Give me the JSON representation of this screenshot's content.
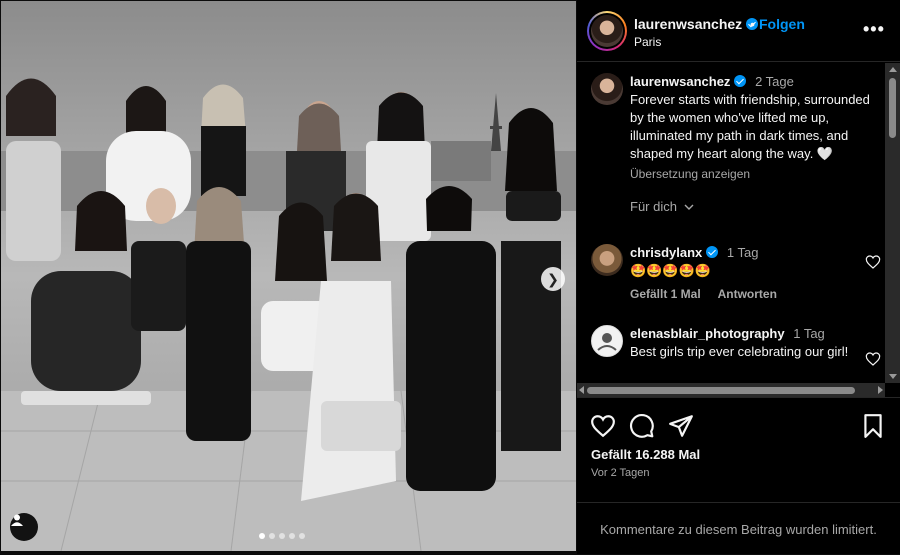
{
  "header": {
    "username": "laurenwsanchez",
    "separator": "•",
    "follow_label": "Folgen",
    "location": "Paris",
    "more_label": "•••"
  },
  "caption": {
    "username": "laurenwsanchez",
    "time": "2 Tage",
    "text": "Forever starts with friendship, surrounded by the women who've lifted me up, illuminated my path in dark times, and shaped my heart along the way. 🤍",
    "translate_label": "Übersetzung anzeigen",
    "for_you_label": "Für dich"
  },
  "comments": [
    {
      "username": "chrisdylanx",
      "time": "1 Tag",
      "text": "🤩🤩🤩🤩🤩",
      "likes_label": "Gefällt 1 Mal",
      "reply_label": "Antworten",
      "verified": true
    },
    {
      "username": "elenasblair_photography",
      "time": "1 Tag",
      "text": "Best girls trip ever celebrating our girl!",
      "verified": false
    }
  ],
  "footer": {
    "likes": "Gefällt 16.288 Mal",
    "ago": "Vor 2 Tagen",
    "comments_limited": "Kommentare zu diesem Beitrag wurden limitiert."
  },
  "carousel": {
    "slide_count": 5,
    "active_index": 0
  },
  "colors": {
    "accent": "#0095f6",
    "background": "#000000",
    "muted": "#a8a8a8"
  },
  "icons": [
    "heart-icon",
    "comment-icon",
    "share-icon",
    "bookmark-icon",
    "user-tag-icon",
    "chevron-right-icon",
    "chevron-down-icon"
  ]
}
